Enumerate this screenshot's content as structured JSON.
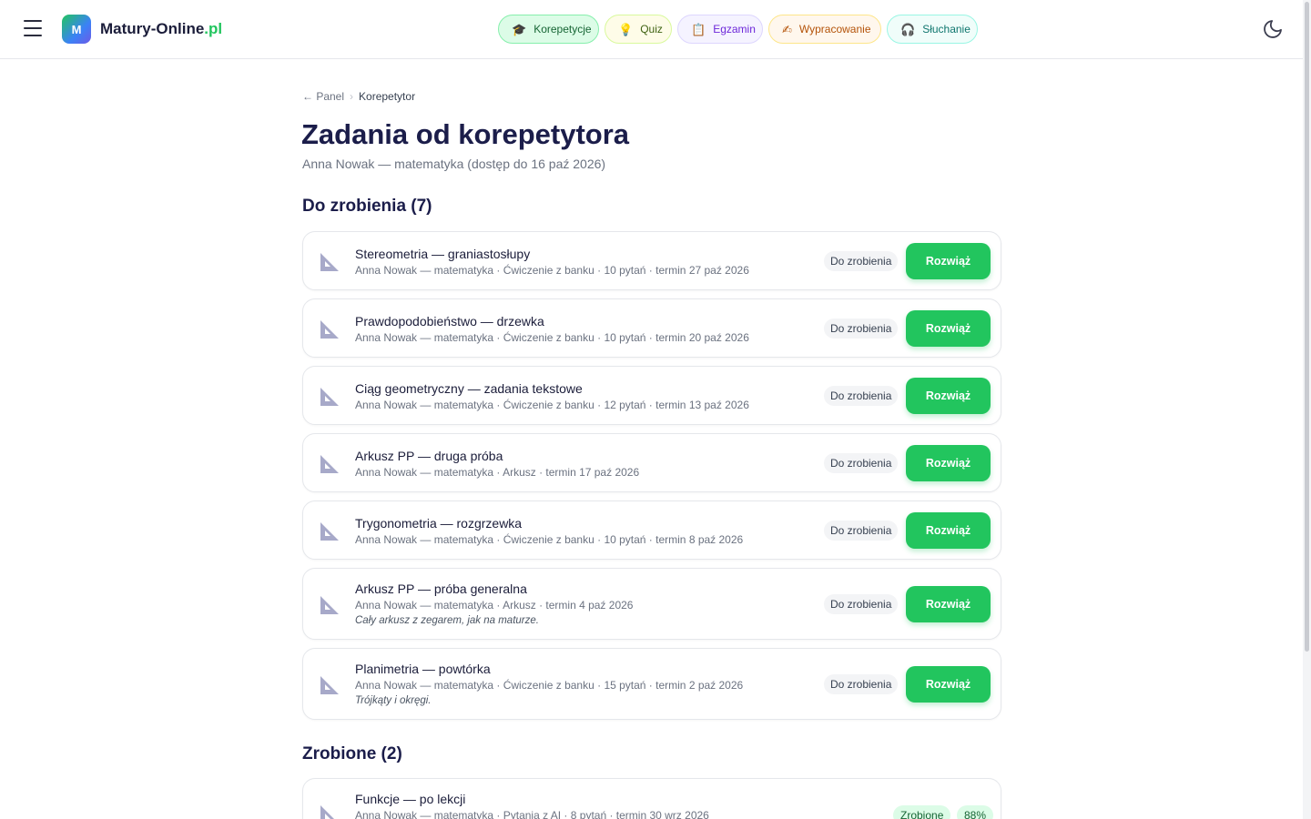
{
  "header": {
    "logo_letter": "M",
    "brand_name": "Matury-Online",
    "brand_tld": ".pl",
    "nav": [
      {
        "label": "Korepetycje",
        "icon": "graduation-cap-icon"
      },
      {
        "label": "Quiz",
        "icon": "lightbulb-icon"
      },
      {
        "label": "Egzamin",
        "icon": "clipboard-icon"
      },
      {
        "label": "Wypracowanie",
        "icon": "writing-hand-icon"
      },
      {
        "label": "Słuchanie",
        "icon": "headphones-icon"
      }
    ],
    "theme_icon": "moon-icon"
  },
  "breadcrumb": {
    "back": "← Panel",
    "sep": "›",
    "current": "Korepetytor"
  },
  "page": {
    "title": "Zadania od korepetytora",
    "subtitle": "Anna Nowak — matematyka (dostęp do 16 paź 2026)"
  },
  "todo": {
    "heading": "Do zrobienia (7)",
    "items": [
      {
        "title": "Stereometria — graniastosłupy",
        "meta": "Anna Nowak — matematyka · Ćwiczenie z banku · 10 pytań · termin 27 paź 2026",
        "note": "",
        "status": "Do zrobienia",
        "action": "Rozwiąż"
      },
      {
        "title": "Prawdopodobieństwo — drzewka",
        "meta": "Anna Nowak — matematyka · Ćwiczenie z banku · 10 pytań · termin 20 paź 2026",
        "note": "",
        "status": "Do zrobienia",
        "action": "Rozwiąż"
      },
      {
        "title": "Ciąg geometryczny — zadania tekstowe",
        "meta": "Anna Nowak — matematyka · Ćwiczenie z banku · 12 pytań · termin 13 paź 2026",
        "note": "",
        "status": "Do zrobienia",
        "action": "Rozwiąż"
      },
      {
        "title": "Arkusz PP — druga próba",
        "meta": "Anna Nowak — matematyka · Arkusz · termin 17 paź 2026",
        "note": "",
        "status": "Do zrobienia",
        "action": "Rozwiąż"
      },
      {
        "title": "Trygonometria — rozgrzewka",
        "meta": "Anna Nowak — matematyka · Ćwiczenie z banku · 10 pytań · termin 8 paź 2026",
        "note": "",
        "status": "Do zrobienia",
        "action": "Rozwiąż"
      },
      {
        "title": "Arkusz PP — próba generalna",
        "meta": "Anna Nowak — matematyka · Arkusz · termin 4 paź 2026",
        "note": "Cały arkusz z zegarem, jak na maturze.",
        "status": "Do zrobienia",
        "action": "Rozwiąż"
      },
      {
        "title": "Planimetria — powtórka",
        "meta": "Anna Nowak — matematyka · Ćwiczenie z banku · 15 pytań · termin 2 paź 2026",
        "note": "Trójkąty i okręgi.",
        "status": "Do zrobienia",
        "action": "Rozwiąż"
      }
    ]
  },
  "done": {
    "heading": "Zrobione (2)",
    "items": [
      {
        "title": "Funkcje — po lekcji",
        "meta": "Anna Nowak — matematyka · Pytania z AI · 8 pytań · termin 30 wrz 2026",
        "status": "Zrobione",
        "score": "88%"
      }
    ]
  },
  "colors": {
    "accent": "#22c55e",
    "title": "#1b1d4a",
    "muted": "#6b7280",
    "ruler": "#a7a9c9"
  }
}
